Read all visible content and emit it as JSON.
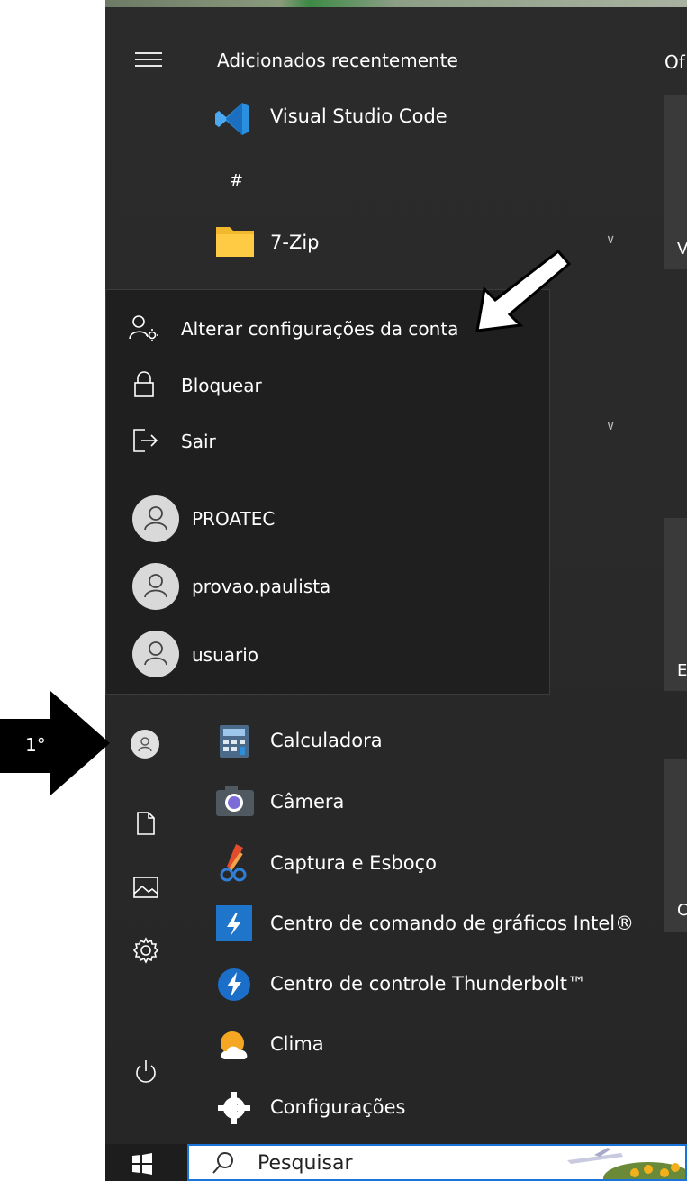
{
  "menu": {
    "recent_header": "Adicionados recentemente",
    "tiles_header": "Of",
    "apps_top": [
      {
        "label": "Visual Studio Code",
        "icon": "vscode-icon"
      },
      {
        "label": "#",
        "icon": ""
      },
      {
        "label": "7-Zip",
        "icon": "folder-icon"
      }
    ],
    "tile_letters": [
      "V",
      "E",
      "C"
    ]
  },
  "account_popup": {
    "actions": [
      {
        "label": "Alterar configurações da conta",
        "icon": "account-settings-icon"
      },
      {
        "label": "Bloquear",
        "icon": "lock-icon"
      },
      {
        "label": "Sair",
        "icon": "sign-out-icon"
      }
    ],
    "users": [
      {
        "name": "PROATEC"
      },
      {
        "name": "provao.paulista"
      },
      {
        "name": "usuario"
      }
    ]
  },
  "apps_list": [
    {
      "label": "Calculadora",
      "icon": "calculator-icon"
    },
    {
      "label": "Câmera",
      "icon": "camera-icon"
    },
    {
      "label": "Captura e Esboço",
      "icon": "snip-sketch-icon"
    },
    {
      "label": "Centro de comando de gráficos Intel®",
      "icon": "intel-graphics-icon"
    },
    {
      "label": "Centro de controle Thunderbolt™",
      "icon": "thunderbolt-icon"
    },
    {
      "label": "Clima",
      "icon": "weather-icon"
    },
    {
      "label": "Configurações",
      "icon": "settings-gear-icon"
    }
  ],
  "annotation": {
    "step_label": "1°"
  },
  "taskbar": {
    "search_placeholder": "Pesquisar"
  },
  "colors": {
    "start_bg": "#2b2b2b",
    "popup_bg": "#1f1f1f",
    "search_border": "#1a73d9"
  }
}
